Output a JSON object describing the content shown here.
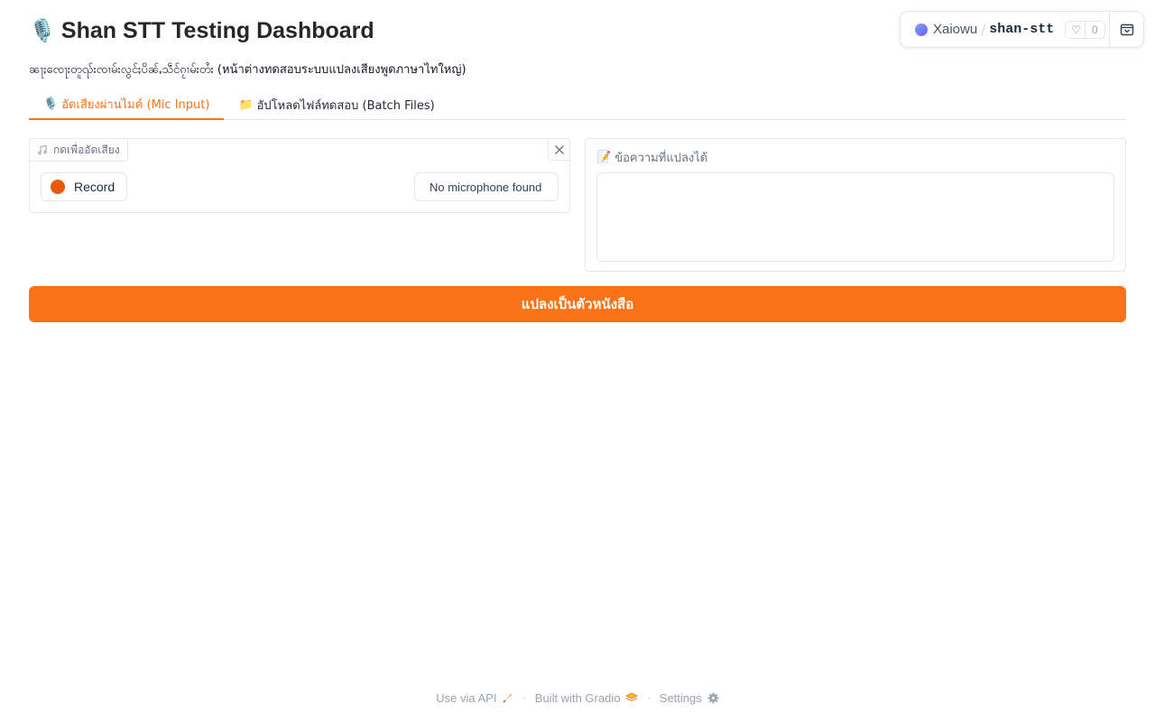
{
  "header": {
    "title_icon": "microphone-icon",
    "title": "Shan STT Testing Dashboard",
    "subtitle": "ၼႃႈၸေႃးတူၺ်းၸၢမ်းလွင်ႈပိၼ်ႇသဵင်ၵႂၢမ်းတႆး (หน้าต่างทดสอบระบบแปลงเสียงพูดภาษาไทใหญ่)"
  },
  "space_badge": {
    "owner": "Xaiowu",
    "name": "shan-stt",
    "likes": "0"
  },
  "tabs": [
    {
      "icon": "🎙️",
      "label": "อัดเสียงผ่านไมค์ (Mic Input)",
      "active": true
    },
    {
      "icon": "📁",
      "label": "อัปโหลดไฟล์ทดสอบ (Batch Files)",
      "active": false
    }
  ],
  "audio_input": {
    "label": "กดเพื่ออัดเสียง",
    "record_label": "Record",
    "mic_select": "No microphone found"
  },
  "output": {
    "label_icon": "📝",
    "label": "ข้อความที่แปลงได้",
    "value": ""
  },
  "submit": {
    "label": "แปลงเป็นตัวหนังสือ"
  },
  "footer": {
    "api_label": "Use via API",
    "built_label": "Built with Gradio",
    "settings_label": "Settings"
  },
  "colors": {
    "accent": "#f97316",
    "record_dot": "#ea580c"
  }
}
